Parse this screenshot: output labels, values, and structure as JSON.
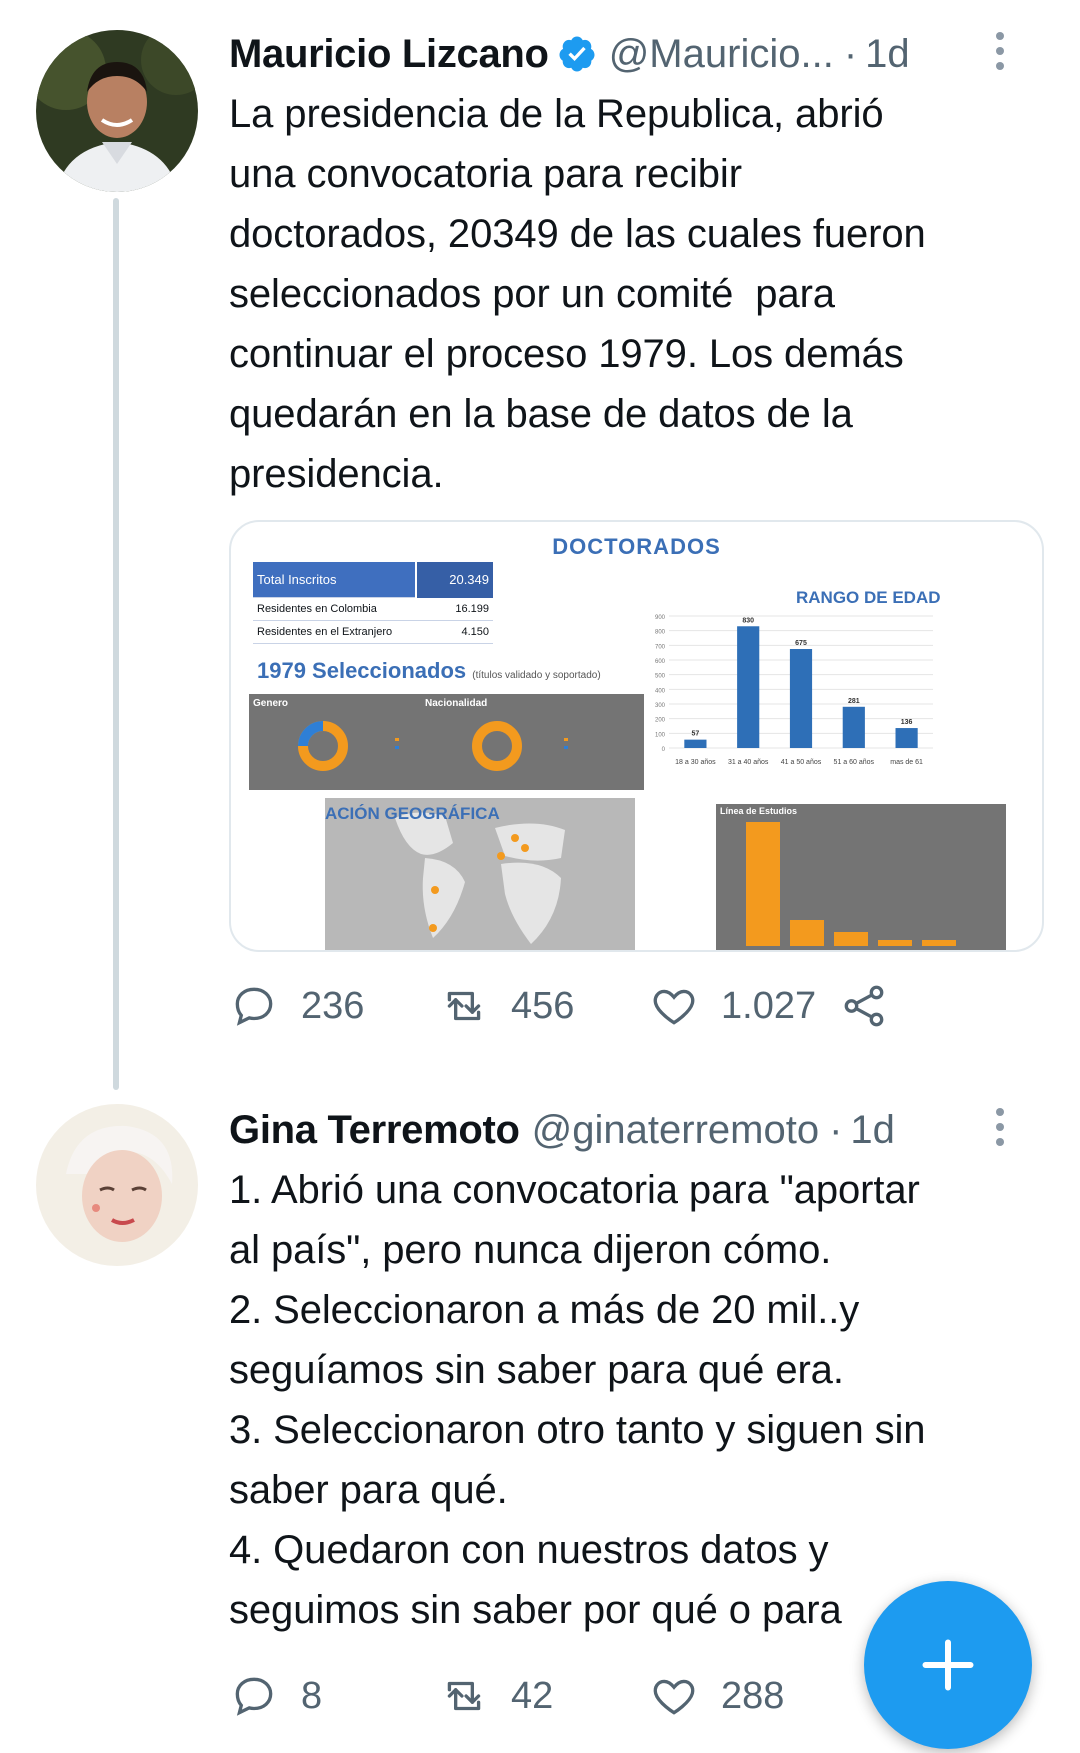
{
  "tweets": [
    {
      "name": "Mauricio Lizcano",
      "verified": true,
      "handle": "@Mauricio...",
      "separator": "·",
      "time": "1d",
      "text": "La presidencia de la Republica, abrió\nuna convocatoria para recibir\ndoctorados, 20349 de las cuales fueron\nseleccionados por un comité  para\ncontinuar el proceso 1979. Los demás\nquedarán en la base de datos de la\npresidencia.",
      "replies": "236",
      "retweets": "456",
      "likes": "1.027",
      "media": {
        "title": "DOCTORADOS",
        "table": {
          "head_label": "Total Inscritos",
          "head_value": "20.349",
          "rows": [
            {
              "label": "Residentes en Colombia",
              "value": "16.199"
            },
            {
              "label": "Residentes en el Extranjero",
              "value": "4.150"
            }
          ]
        },
        "selected": "1979 Seleccionados",
        "selected_note": "(títulos validado y soportado)",
        "gender_label": "Genero",
        "nationality_label": "Nacionalidad",
        "map_title": "ACIÓN GEOGRÁFICA",
        "study_title": "Línea de Estudios",
        "age_chart_title": "RANGO DE EDAD"
      }
    },
    {
      "name": "Gina Terremoto",
      "verified": false,
      "handle": "@ginaterremoto",
      "separator": "·",
      "time": "1d",
      "text": "1. Abrió una convocatoria para \"aportar\nal país\", pero nunca dijeron cómo.\n2. Seleccionaron a más de 20 mil..y\nseguíamos sin saber para qué era.\n3. Seleccionaron otro tanto y siguen sin\nsaber para qué.\n4. Quedaron con nuestros datos y\nseguimos sin saber por qué o para",
      "replies": "8",
      "retweets": "42",
      "likes": "288"
    }
  ],
  "chart_data": {
    "type": "bar",
    "title": "RANGO DE EDAD",
    "categories": [
      "18 a 30 años",
      "31 a 40 años",
      "41 a 50 años",
      "51 a 60 años",
      "mas de 61"
    ],
    "values": [
      57,
      830,
      675,
      281,
      136
    ],
    "ylim": [
      0,
      900
    ],
    "yticks": [
      0,
      100,
      200,
      300,
      400,
      500,
      600,
      700,
      800,
      900
    ],
    "color": "#2e6fb7"
  },
  "colors": {
    "accent": "#1d9bf0",
    "muted": "#536471",
    "orange": "#f39a1e"
  },
  "icons": {
    "reply": "reply-icon",
    "retweet": "retweet-icon",
    "like": "heart-icon",
    "share": "share-icon",
    "compose": "plus-icon"
  }
}
